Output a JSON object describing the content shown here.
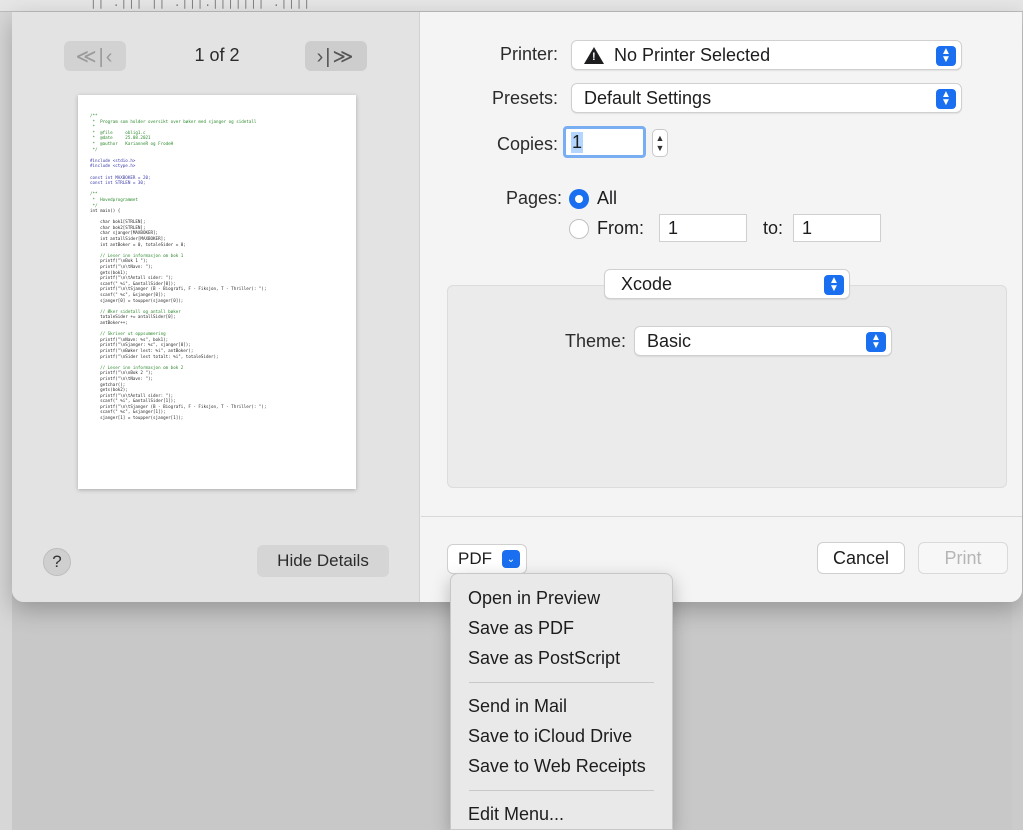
{
  "background": {
    "top_text": "|| .||| || .|||.||||||| .||||"
  },
  "preview": {
    "prev_label": "≪|‹",
    "next_label": "›|≫",
    "page_indicator": "1 of 2",
    "code_lines": [
      {
        "t": "/**",
        "k": "c"
      },
      {
        "t": " *  Program som holder oversikt over bøker med sjanger og sidetall",
        "k": "c"
      },
      {
        "t": " *",
        "k": "c"
      },
      {
        "t": " *  @file     oblig1.c",
        "k": "c"
      },
      {
        "t": " *  @date     25.08.2021",
        "k": "c"
      },
      {
        "t": " *  @author   KarianneR og FrodeH",
        "k": "c"
      },
      {
        "t": " */",
        "k": "c"
      },
      {
        "t": "",
        "k": ""
      },
      {
        "t": "#include <stdio.h>",
        "k": "k"
      },
      {
        "t": "#include <ctype.h>",
        "k": "k"
      },
      {
        "t": "",
        "k": ""
      },
      {
        "t": "const int MAXBOKER = 20;",
        "k": "k"
      },
      {
        "t": "const int STRLEN = 30;",
        "k": "k"
      },
      {
        "t": "",
        "k": ""
      },
      {
        "t": "/**",
        "k": "c"
      },
      {
        "t": " *  Hovedprogrammet",
        "k": "c"
      },
      {
        "t": " */",
        "k": "c"
      },
      {
        "t": "int main() {",
        "k": ""
      },
      {
        "t": "",
        "k": ""
      },
      {
        "t": "    char bok1[STRLEN];",
        "k": ""
      },
      {
        "t": "    char bok2[STRLEN];",
        "k": ""
      },
      {
        "t": "    char sjanger[MAXBOKER];",
        "k": ""
      },
      {
        "t": "    int antallSider[MAXBOKER];",
        "k": ""
      },
      {
        "t": "    int antBoker = 0, totaleSider = 0;",
        "k": ""
      },
      {
        "t": "",
        "k": ""
      },
      {
        "t": "    // Leser inn informasjon om bok 1",
        "k": "c"
      },
      {
        "t": "    printf(\"\\nBok 1 \");",
        "k": ""
      },
      {
        "t": "    printf(\"\\n\\tNavn: \");",
        "k": ""
      },
      {
        "t": "    gets(bok1);",
        "k": ""
      },
      {
        "t": "    printf(\"\\n\\tAntall sider: \");",
        "k": ""
      },
      {
        "t": "    scanf(\" %i\", &antallSider[0]);",
        "k": ""
      },
      {
        "t": "    printf(\"\\n\\tSjanger (B - Biografi, F - Fiksjon, T - Thriller): \");",
        "k": ""
      },
      {
        "t": "    scanf(\" %c\", &sjanger[0]);",
        "k": ""
      },
      {
        "t": "    sjanger[0] = toupper(sjanger[0]);",
        "k": ""
      },
      {
        "t": "",
        "k": ""
      },
      {
        "t": "    // Øker sidetall og antall bøker",
        "k": "c"
      },
      {
        "t": "    totaleSider += antallSider[0];",
        "k": ""
      },
      {
        "t": "    antBoker++;",
        "k": ""
      },
      {
        "t": "",
        "k": ""
      },
      {
        "t": "    // Skriver ut oppsummering",
        "k": "c"
      },
      {
        "t": "    printf(\"\\nNavn: %s\", bok1);",
        "k": ""
      },
      {
        "t": "    printf(\"\\nSjanger: %c\", sjanger[0]);",
        "k": ""
      },
      {
        "t": "    printf(\"\\nBøker lest: %i\", antBoker);",
        "k": ""
      },
      {
        "t": "    printf(\"\\nSider lest totalt: %i\", totaleSider);",
        "k": ""
      },
      {
        "t": "",
        "k": ""
      },
      {
        "t": "    // Leser inn informasjon om bok 2",
        "k": "c"
      },
      {
        "t": "    printf(\"\\n\\nBok 2 \");",
        "k": ""
      },
      {
        "t": "    printf(\"\\n\\tNavn: \");",
        "k": ""
      },
      {
        "t": "    getchar();",
        "k": ""
      },
      {
        "t": "    gets(bok2);",
        "k": ""
      },
      {
        "t": "    printf(\"\\n\\tAntall sider: \");",
        "k": ""
      },
      {
        "t": "    scanf(\" %i\", &antallSider[1]);",
        "k": ""
      },
      {
        "t": "    printf(\"\\n\\tSjanger (B - Biografi, F - Fiksjon, T - Thriller): \");",
        "k": ""
      },
      {
        "t": "    scanf(\" %c\", &sjanger[1]);",
        "k": ""
      },
      {
        "t": "    sjanger[1] = toupper(sjanger[1]);",
        "k": ""
      }
    ],
    "help_label": "?",
    "hide_details_label": "Hide Details"
  },
  "form": {
    "printer_label": "Printer:",
    "printer_value": "No Printer Selected",
    "presets_label": "Presets:",
    "presets_value": "Default Settings",
    "copies_label": "Copies:",
    "copies_value": "1",
    "pages_label": "Pages:",
    "pages_all_label": "All",
    "pages_from_label": "From:",
    "pages_from_value": "1",
    "pages_to_label": "to:",
    "pages_to_value": "1",
    "section_value": "Xcode",
    "theme_label": "Theme:",
    "theme_value": "Basic"
  },
  "footer": {
    "pdf_label": "PDF",
    "cancel_label": "Cancel",
    "print_label": "Print"
  },
  "pdf_menu": {
    "group1": [
      "Open in Preview",
      "Save as PDF",
      "Save as PostScript"
    ],
    "group2": [
      "Send in Mail",
      "Save to iCloud Drive",
      "Save to Web Receipts"
    ],
    "group3": [
      "Edit Menu..."
    ]
  },
  "colors": {
    "accent": "#1a6ff0",
    "comment_green": "#2d8a2d",
    "keyword_blue": "#3a3aa8"
  }
}
